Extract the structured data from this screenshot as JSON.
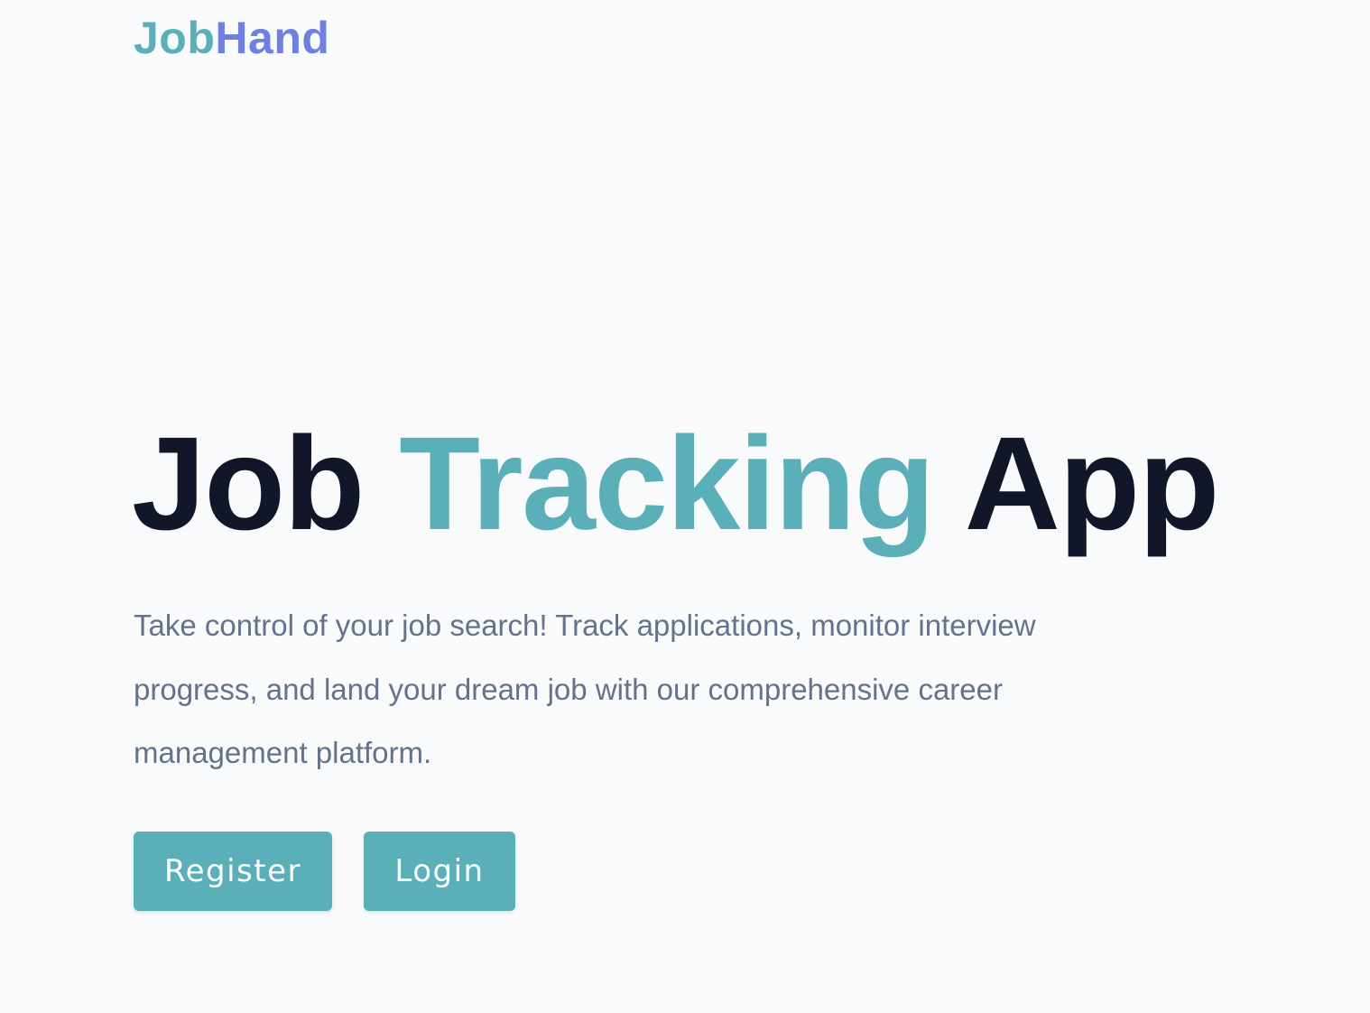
{
  "header": {
    "logo_part_1": "Job",
    "logo_part_2": "Hand"
  },
  "hero": {
    "title_part_1": "Job ",
    "title_accent": "Tracking",
    "title_part_2": " App",
    "description": "Take control of your job search! Track applications, monitor interview progress, and land your dream job with our comprehensive career management platform."
  },
  "actions": {
    "register_label": "Register",
    "login_label": "Login"
  },
  "colors": {
    "background": "#f8fafc",
    "primary": "#5aafb9",
    "logo_secondary": "#6f80df",
    "heading": "#121629",
    "body_text": "#65728a"
  }
}
